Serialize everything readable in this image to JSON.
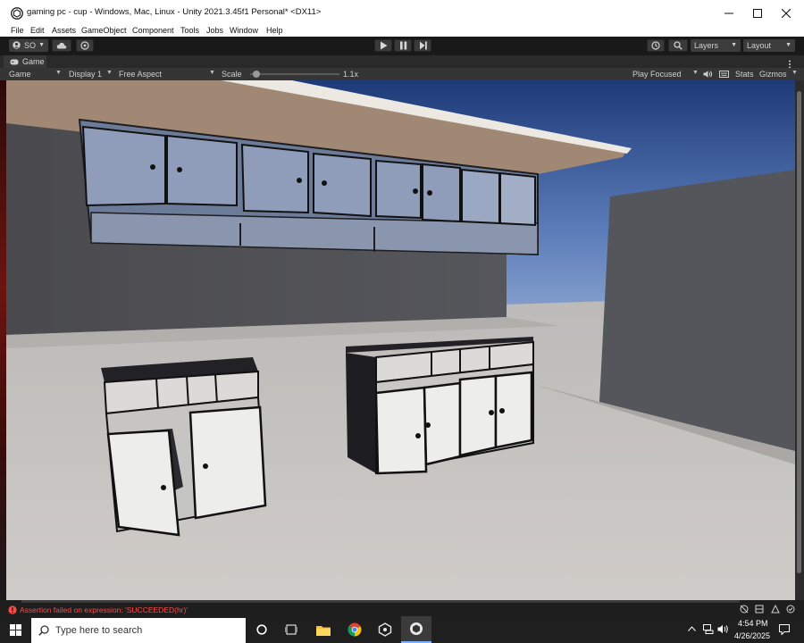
{
  "window": {
    "title": "gaming pc - cup - Windows, Mac, Linux - Unity 2021.3.45f1 Personal* <DX11>"
  },
  "menu": [
    "File",
    "Edit",
    "Assets",
    "GameObject",
    "Component",
    "Tools",
    "Jobs",
    "Window",
    "Help"
  ],
  "toolbar": {
    "account_label": "SO",
    "layers_label": "Layers",
    "layout_label": "Layout"
  },
  "game_tab": {
    "label": "Game"
  },
  "game_toolbar": {
    "mode": "Game",
    "display": "Display 1",
    "aspect": "Free Aspect",
    "scale_label": "Scale",
    "scale_value": "1.1x",
    "scale_fraction": 0.03,
    "play_mode": "Play Focused",
    "stats_label": "Stats",
    "gizmos_label": "Gizmos"
  },
  "console": {
    "message": "Assertion failed on expression: 'SUCCEEDED(hr)'",
    "error_color": "#ff4a4a"
  },
  "taskbar": {
    "search_placeholder": "Type here to search",
    "time": "4:54 PM",
    "date": "4/26/2025"
  },
  "colors": {
    "editor_dark": "#191919",
    "panel": "#353535",
    "sky_top": "#1d3a78",
    "sky_bottom": "#97afd6",
    "floor": "#c9c6c2"
  }
}
